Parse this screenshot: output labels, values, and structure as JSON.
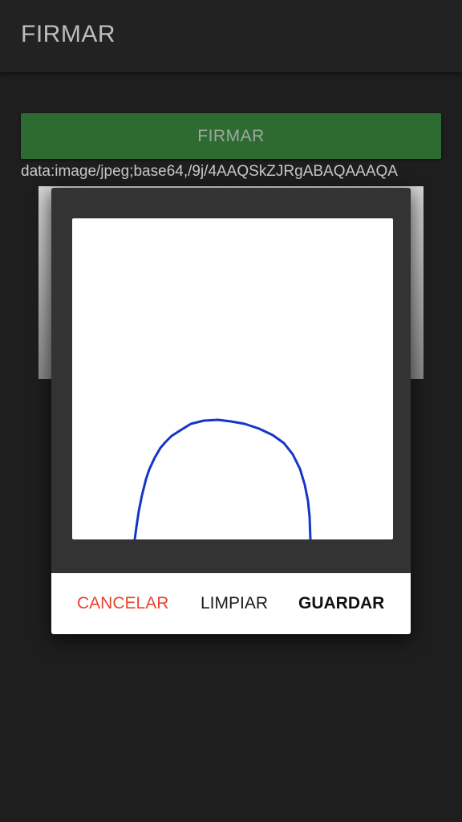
{
  "app_bar": {
    "title": "FIRMAR"
  },
  "main": {
    "sign_button_label": "FIRMAR",
    "signature_data_url": "data:image/jpeg;base64,/9j/4AAQSkZJRgABAQAAAQA"
  },
  "dialog": {
    "actions": {
      "cancel_label": "CANCELAR",
      "clear_label": "LIMPIAR",
      "save_label": "GUARDAR"
    }
  },
  "colors": {
    "background": "#1e1e1e",
    "app_bar": "#222222",
    "button_green": "#2e6b30",
    "cancel_red": "#e8432f",
    "stroke_blue": "#1535c8"
  }
}
